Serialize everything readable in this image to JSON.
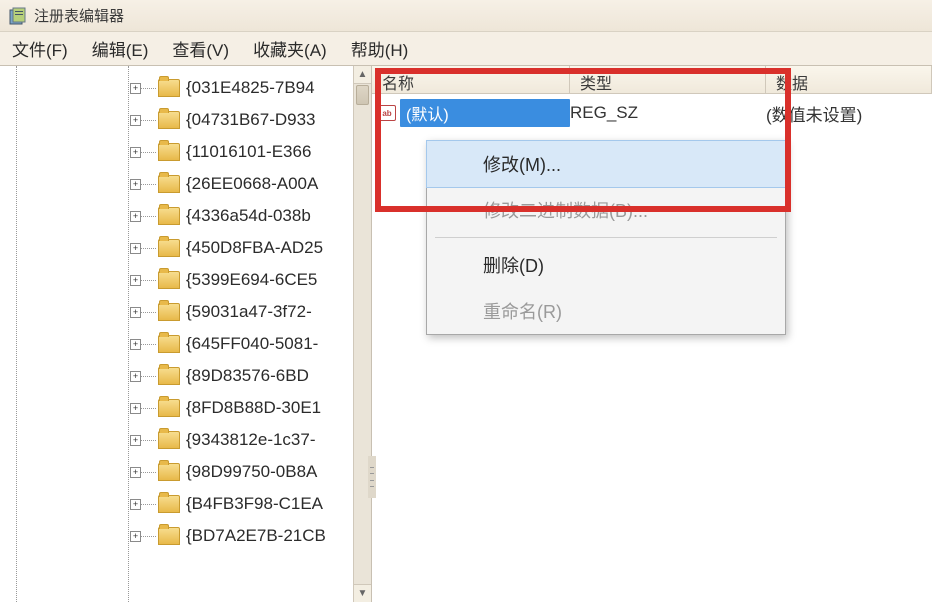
{
  "window": {
    "title": "注册表编辑器"
  },
  "menubar": {
    "file": "文件(F)",
    "edit": "编辑(E)",
    "view": "查看(V)",
    "favorites": "收藏夹(A)",
    "help": "帮助(H)"
  },
  "tree": {
    "items": [
      "{031E4825-7B94",
      "{04731B67-D933",
      "{11016101-E366",
      "{26EE0668-A00A",
      "{4336a54d-038b",
      "{450D8FBA-AD25",
      "{5399E694-6CE5",
      "{59031a47-3f72-",
      "{645FF040-5081-",
      "{89D83576-6BD",
      "{8FD8B88D-30E1",
      "{9343812e-1c37-",
      "{98D99750-0B8A",
      "{B4FB3F98-C1EA",
      "{BD7A2E7B-21CB"
    ]
  },
  "list": {
    "columns": {
      "name": "名称",
      "type": "类型",
      "data": "数据"
    },
    "rows": [
      {
        "name": "(默认)",
        "type": "REG_SZ",
        "data": "(数值未设置)"
      }
    ]
  },
  "context_menu": {
    "modify": "修改(M)...",
    "modify_binary": "修改二进制数据(B)...",
    "delete": "删除(D)",
    "rename": "重命名(R)"
  }
}
